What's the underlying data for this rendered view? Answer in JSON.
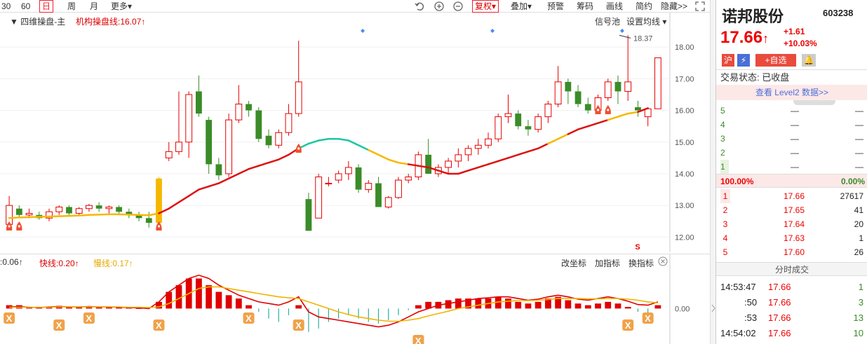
{
  "toolbar": {
    "periods": [
      "30",
      "60",
      "日",
      "周",
      "月",
      "更多▾"
    ],
    "selected_period": "日",
    "fq_label": "复权▾",
    "overlay_label": "叠加▾",
    "warn_label": "预警",
    "chips_label": "筹码",
    "draw_label": "画线",
    "simple_label": "简约",
    "hide_label": "隐藏>>"
  },
  "main_chart": {
    "indicator_name": "▼ 四维操盘-主",
    "line_label": "机构操盘线:16.07↑",
    "signal_pool": "信号池",
    "ma_settings": "设置均线 ▾",
    "max_label": "18.37",
    "sell_mark": "S",
    "price_ticks": [
      "18.00",
      "17.00",
      "16.00",
      "15.00",
      "14.00",
      "13.00",
      "12.00"
    ]
  },
  "sub_chart": {
    "labels": [
      ":0.06↑",
      "快线:0.20↑",
      "慢线:0.17↑"
    ],
    "btn_coord": "改坐标",
    "btn_add": "加指标",
    "btn_switch": "换指标",
    "zero_tick": "0.00"
  },
  "quote": {
    "name": "诺邦股份",
    "code": "603238",
    "price": "17.66",
    "arrow": "↑",
    "change": "+1.61",
    "change_pct": "+10.03%",
    "tag_sh": "沪",
    "tag_add": "+自选",
    "status_label": "交易状态: 已收盘",
    "level2_label": "查看 Level2 数据>>",
    "sell_rows": [
      {
        "lvl": "5",
        "price": "—",
        "vol": "—"
      },
      {
        "lvl": "4",
        "price": "—",
        "vol": "—"
      },
      {
        "lvl": "3",
        "price": "—",
        "vol": "—"
      },
      {
        "lvl": "2",
        "price": "—",
        "vol": "—"
      },
      {
        "lvl": "1",
        "price": "—",
        "vol": "—"
      }
    ],
    "ratio_left": "100.00%",
    "ratio_right": "0.00%",
    "buy_rows": [
      {
        "lvl": "1",
        "price": "17.66",
        "vol": "27617"
      },
      {
        "lvl": "2",
        "price": "17.65",
        "vol": "41"
      },
      {
        "lvl": "3",
        "price": "17.64",
        "vol": "20"
      },
      {
        "lvl": "4",
        "price": "17.63",
        "vol": "1"
      },
      {
        "lvl": "5",
        "price": "17.60",
        "vol": "26"
      }
    ],
    "ticks_title": "分时成交",
    "ticks": [
      {
        "time": "14:53:47",
        "price": "17.66",
        "vol": "1"
      },
      {
        "time": ":50",
        "price": "17.66",
        "vol": "3"
      },
      {
        "time": ":53",
        "price": "17.66",
        "vol": "13"
      },
      {
        "time": "14:54:02",
        "price": "17.66",
        "vol": "10"
      }
    ]
  },
  "colors": {
    "up": "#e60000",
    "down": "#3a8c28",
    "ma": "#d11",
    "ma_alt": "#f5b800",
    "ma_green": "#1cc7a0",
    "macd_fast": "#e00000",
    "macd_slow": "#f0b400"
  },
  "chart_data": {
    "type": "candlestick",
    "candles": [
      {
        "o": 12.4,
        "h": 13.3,
        "l": 12.3,
        "c": 13.0
      },
      {
        "o": 12.9,
        "h": 13.0,
        "l": 12.6,
        "c": 12.7
      },
      {
        "o": 12.7,
        "h": 12.9,
        "l": 12.6,
        "c": 12.75
      },
      {
        "o": 12.7,
        "h": 12.8,
        "l": 12.55,
        "c": 12.6
      },
      {
        "o": 12.6,
        "h": 12.9,
        "l": 12.5,
        "c": 12.8
      },
      {
        "o": 12.8,
        "h": 13.0,
        "l": 12.7,
        "c": 12.95
      },
      {
        "o": 12.95,
        "h": 13.0,
        "l": 12.7,
        "c": 12.75
      },
      {
        "o": 12.75,
        "h": 12.95,
        "l": 12.7,
        "c": 12.9
      },
      {
        "o": 12.9,
        "h": 13.05,
        "l": 12.8,
        "c": 13.0
      },
      {
        "o": 13.0,
        "h": 13.1,
        "l": 12.8,
        "c": 12.9
      },
      {
        "o": 12.9,
        "h": 13.0,
        "l": 12.75,
        "c": 12.95
      },
      {
        "o": 12.95,
        "h": 13.0,
        "l": 12.75,
        "c": 12.8
      },
      {
        "o": 12.8,
        "h": 12.9,
        "l": 12.6,
        "c": 12.7
      },
      {
        "o": 12.7,
        "h": 12.8,
        "l": 12.5,
        "c": 12.6
      },
      {
        "o": 12.6,
        "h": 12.8,
        "l": 12.3,
        "c": 12.45
      },
      {
        "o": 12.45,
        "h": 13.9,
        "l": 12.4,
        "c": 13.85
      },
      {
        "o": 14.5,
        "h": 15.0,
        "l": 14.4,
        "c": 14.7
      },
      {
        "o": 14.7,
        "h": 16.6,
        "l": 14.6,
        "c": 15.0
      },
      {
        "o": 15.0,
        "h": 16.6,
        "l": 14.5,
        "c": 16.5
      },
      {
        "o": 16.6,
        "h": 17.1,
        "l": 15.8,
        "c": 15.9
      },
      {
        "o": 15.7,
        "h": 15.8,
        "l": 14.0,
        "c": 14.3
      },
      {
        "o": 14.3,
        "h": 14.5,
        "l": 13.8,
        "c": 13.95
      },
      {
        "o": 14.0,
        "h": 15.9,
        "l": 13.9,
        "c": 15.7
      },
      {
        "o": 15.7,
        "h": 16.8,
        "l": 15.6,
        "c": 16.2
      },
      {
        "o": 16.2,
        "h": 16.3,
        "l": 15.8,
        "c": 16.0
      },
      {
        "o": 16.0,
        "h": 16.1,
        "l": 15.0,
        "c": 15.1
      },
      {
        "o": 15.2,
        "h": 15.4,
        "l": 14.8,
        "c": 14.9
      },
      {
        "o": 14.9,
        "h": 15.4,
        "l": 14.8,
        "c": 15.3
      },
      {
        "o": 15.3,
        "h": 16.2,
        "l": 15.2,
        "c": 15.9
      },
      {
        "o": 15.9,
        "h": 18.2,
        "l": 15.8,
        "c": 16.9
      },
      {
        "o": 13.2,
        "h": 13.4,
        "l": 12.2,
        "c": 12.2
      },
      {
        "o": 12.6,
        "h": 14.0,
        "l": 12.6,
        "c": 13.9
      },
      {
        "o": 13.7,
        "h": 13.9,
        "l": 13.6,
        "c": 13.7
      },
      {
        "o": 13.8,
        "h": 14.1,
        "l": 13.7,
        "c": 14.0
      },
      {
        "o": 14.0,
        "h": 14.4,
        "l": 13.8,
        "c": 14.2
      },
      {
        "o": 14.2,
        "h": 14.3,
        "l": 13.4,
        "c": 13.5
      },
      {
        "o": 13.5,
        "h": 13.8,
        "l": 13.4,
        "c": 13.7
      },
      {
        "o": 13.7,
        "h": 13.9,
        "l": 13.0,
        "c": 12.95
      },
      {
        "o": 12.95,
        "h": 13.3,
        "l": 12.9,
        "c": 13.25
      },
      {
        "o": 13.25,
        "h": 13.9,
        "l": 13.2,
        "c": 13.8
      },
      {
        "o": 13.8,
        "h": 14.0,
        "l": 13.7,
        "c": 13.9
      },
      {
        "o": 13.9,
        "h": 14.7,
        "l": 13.8,
        "c": 14.6
      },
      {
        "o": 14.6,
        "h": 15.1,
        "l": 14.0,
        "c": 14.0
      },
      {
        "o": 14.0,
        "h": 14.3,
        "l": 13.9,
        "c": 14.2
      },
      {
        "o": 14.2,
        "h": 14.5,
        "l": 14.0,
        "c": 14.4
      },
      {
        "o": 14.4,
        "h": 14.8,
        "l": 14.2,
        "c": 14.6
      },
      {
        "o": 14.6,
        "h": 14.9,
        "l": 14.4,
        "c": 14.8
      },
      {
        "o": 14.8,
        "h": 15.1,
        "l": 14.6,
        "c": 14.9
      },
      {
        "o": 14.9,
        "h": 15.3,
        "l": 14.8,
        "c": 15.1
      },
      {
        "o": 15.1,
        "h": 15.9,
        "l": 15.0,
        "c": 15.8
      },
      {
        "o": 15.8,
        "h": 16.5,
        "l": 15.6,
        "c": 15.9
      },
      {
        "o": 15.9,
        "h": 16.0,
        "l": 15.4,
        "c": 15.5
      },
      {
        "o": 15.5,
        "h": 15.7,
        "l": 15.2,
        "c": 15.4
      },
      {
        "o": 15.4,
        "h": 15.9,
        "l": 15.3,
        "c": 15.8
      },
      {
        "o": 15.8,
        "h": 16.3,
        "l": 15.6,
        "c": 16.2
      },
      {
        "o": 16.2,
        "h": 17.4,
        "l": 16.1,
        "c": 16.9
      },
      {
        "o": 16.9,
        "h": 17.0,
        "l": 16.2,
        "c": 16.6
      },
      {
        "o": 16.6,
        "h": 16.8,
        "l": 16.1,
        "c": 16.2
      },
      {
        "o": 16.2,
        "h": 16.4,
        "l": 15.9,
        "c": 16.0
      },
      {
        "o": 16.0,
        "h": 16.5,
        "l": 15.9,
        "c": 16.4
      },
      {
        "o": 16.4,
        "h": 17.0,
        "l": 16.3,
        "c": 16.9
      },
      {
        "o": 16.9,
        "h": 17.1,
        "l": 16.2,
        "c": 16.6
      },
      {
        "o": 16.6,
        "h": 18.37,
        "l": 16.3,
        "c": 16.9
      },
      {
        "o": 16.1,
        "h": 16.3,
        "l": 15.8,
        "c": 16.0
      },
      {
        "o": 15.8,
        "h": 16.1,
        "l": 15.5,
        "c": 16.05
      },
      {
        "o": 16.05,
        "h": 17.66,
        "l": 16.05,
        "c": 17.66
      }
    ],
    "ma": [
      12.6,
      12.62,
      12.63,
      12.64,
      12.65,
      12.66,
      12.67,
      12.68,
      12.7,
      12.71,
      12.72,
      12.72,
      12.71,
      12.7,
      12.69,
      12.75,
      12.9,
      13.1,
      13.3,
      13.5,
      13.6,
      13.7,
      13.85,
      14.0,
      14.15,
      14.25,
      14.35,
      14.45,
      14.6,
      14.8,
      14.95,
      15.05,
      15.1,
      15.1,
      15.05,
      14.9,
      14.75,
      14.6,
      14.45,
      14.35,
      14.3,
      14.25,
      14.2,
      14.1,
      14.0,
      14.0,
      14.1,
      14.2,
      14.3,
      14.4,
      14.5,
      14.6,
      14.7,
      14.8,
      14.95,
      15.1,
      15.25,
      15.4,
      15.5,
      15.6,
      15.7,
      15.8,
      15.9,
      15.95,
      16.07
    ],
    "ylim": [
      11.7,
      18.6
    ],
    "macd_hist": [
      0.1,
      0.1,
      0.05,
      0.04,
      0.06,
      0.08,
      0.05,
      0.06,
      0.07,
      0.05,
      0.06,
      0.04,
      0.02,
      0.01,
      -0.02,
      0.2,
      0.5,
      0.7,
      0.9,
      0.9,
      0.7,
      0.5,
      0.4,
      0.3,
      0.1,
      -0.1,
      -0.3,
      -0.4,
      -0.2,
      0.1,
      -0.7,
      -0.6,
      -0.4,
      -0.3,
      -0.2,
      -0.3,
      -0.4,
      -0.45,
      -0.35,
      -0.2,
      -0.05,
      0.1,
      0.2,
      0.2,
      0.25,
      0.3,
      0.3,
      0.3,
      0.3,
      0.35,
      0.3,
      0.2,
      0.15,
      0.2,
      0.3,
      0.35,
      0.25,
      0.15,
      0.1,
      0.15,
      0.2,
      0.15,
      0.05,
      -0.1,
      -0.15,
      0.1
    ],
    "macd_fast": [
      0.05,
      0.06,
      0.04,
      0.03,
      0.05,
      0.06,
      0.05,
      0.05,
      0.06,
      0.05,
      0.05,
      0.04,
      0.03,
      0.02,
      0.0,
      0.2,
      0.5,
      0.7,
      0.9,
      1.0,
      0.9,
      0.7,
      0.55,
      0.4,
      0.3,
      0.2,
      0.15,
      0.1,
      0.2,
      0.35,
      -0.1,
      -0.25,
      -0.3,
      -0.35,
      -0.4,
      -0.45,
      -0.5,
      -0.55,
      -0.5,
      -0.4,
      -0.25,
      -0.1,
      0.0,
      0.1,
      0.15,
      0.2,
      0.25,
      0.3,
      0.32,
      0.35,
      0.35,
      0.3,
      0.25,
      0.28,
      0.35,
      0.4,
      0.35,
      0.28,
      0.25,
      0.3,
      0.35,
      0.3,
      0.22,
      0.12,
      0.1,
      0.2
    ],
    "macd_slow": [
      0.04,
      0.04,
      0.04,
      0.04,
      0.04,
      0.05,
      0.05,
      0.05,
      0.05,
      0.05,
      0.05,
      0.05,
      0.04,
      0.04,
      0.03,
      0.05,
      0.15,
      0.3,
      0.45,
      0.6,
      0.65,
      0.65,
      0.6,
      0.55,
      0.5,
      0.45,
      0.4,
      0.35,
      0.32,
      0.3,
      0.2,
      0.1,
      0.0,
      -0.1,
      -0.18,
      -0.25,
      -0.3,
      -0.35,
      -0.38,
      -0.38,
      -0.35,
      -0.3,
      -0.22,
      -0.15,
      -0.08,
      0.0,
      0.05,
      0.1,
      0.15,
      0.2,
      0.22,
      0.24,
      0.24,
      0.25,
      0.27,
      0.3,
      0.3,
      0.3,
      0.29,
      0.29,
      0.3,
      0.3,
      0.28,
      0.25,
      0.2,
      0.17
    ],
    "macd_ylim": [
      -1.0,
      1.1
    ]
  }
}
